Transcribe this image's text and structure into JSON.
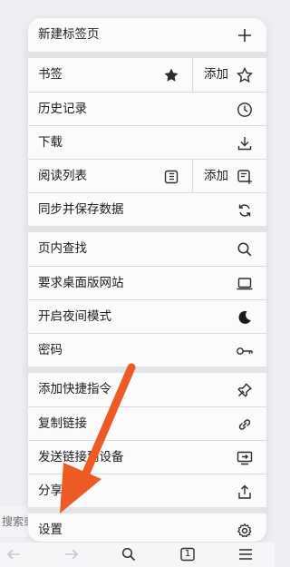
{
  "background": {
    "search_partial": "搜索或"
  },
  "menu": {
    "items": [
      {
        "label": "新建标签页",
        "icon": "plus-icon"
      },
      {
        "label": "书签",
        "icon": "star-filled-icon",
        "add_label": "添加",
        "add_icon": "star-outline-icon"
      },
      {
        "label": "历史记录",
        "icon": "clock-icon"
      },
      {
        "label": "下载",
        "icon": "download-icon"
      },
      {
        "label": "阅读列表",
        "icon": "reading-list-icon",
        "add_label": "添加",
        "add_icon": "reading-list-add-icon"
      },
      {
        "label": "同步并保存数据",
        "icon": "sync-icon"
      },
      {
        "label": "页内查找",
        "icon": "search-icon"
      },
      {
        "label": "要求桌面版网站",
        "icon": "laptop-icon"
      },
      {
        "label": "开启夜间模式",
        "icon": "moon-icon"
      },
      {
        "label": "密码",
        "icon": "key-icon"
      },
      {
        "label": "添加快捷指令",
        "icon": "pin-icon"
      },
      {
        "label": "复制链接",
        "icon": "link-icon"
      },
      {
        "label": "发送链接到设备",
        "icon": "send-to-device-icon"
      },
      {
        "label": "分享",
        "icon": "share-icon"
      },
      {
        "label": "设置",
        "icon": "gear-icon"
      }
    ]
  },
  "toolbar": {
    "tab_count": "1",
    "icons": [
      "back-arrow-icon",
      "forward-arrow-icon",
      "search-icon",
      "tabs-icon",
      "menu-icon"
    ]
  },
  "colors": {
    "accent_arrow": "#ee5a24",
    "icon": "#2c2c2e",
    "separator": "#e3e3e8"
  }
}
